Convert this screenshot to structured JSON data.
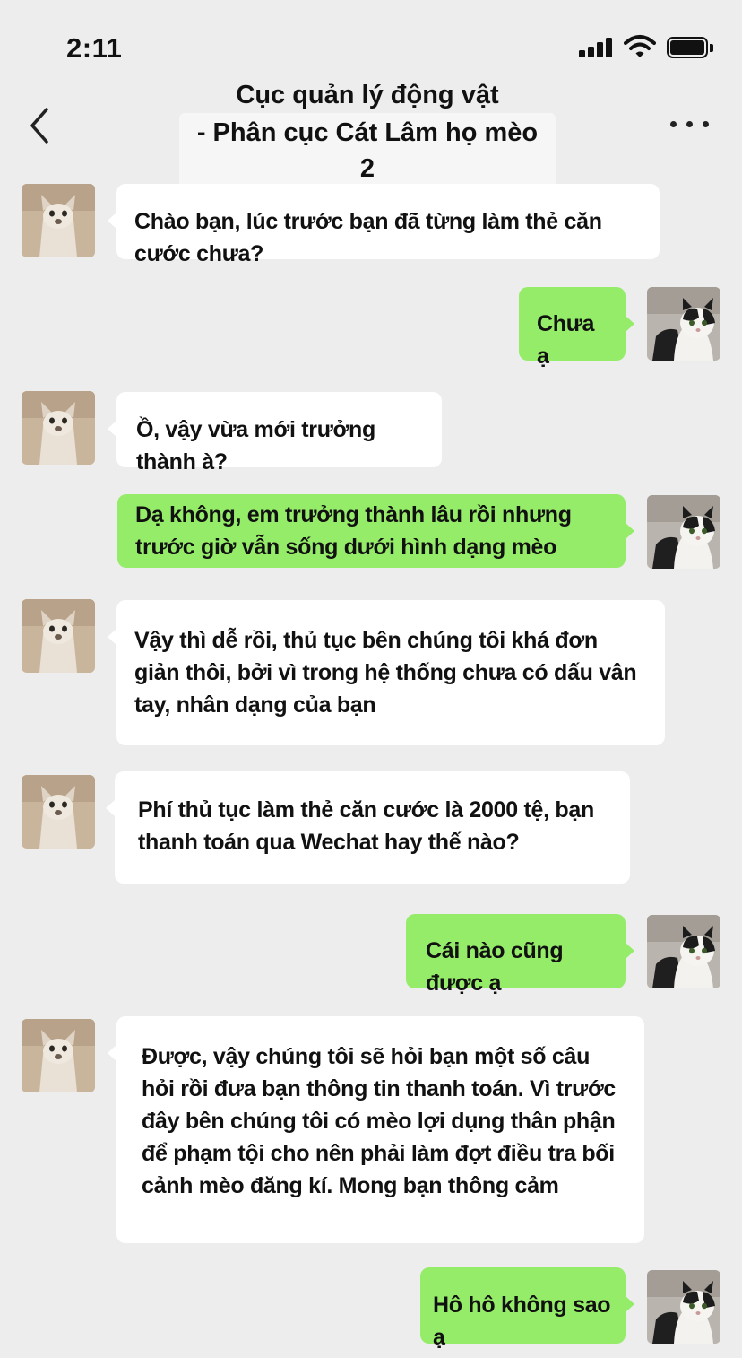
{
  "status": {
    "time": "2:11"
  },
  "header": {
    "title_line1": "Cục quản lý động vật",
    "title_line2": "- Phân cục Cát Lâm họ mèo 2"
  },
  "messages": [
    {
      "side": "left",
      "text": "Chào bạn, lúc trước bạn đã từng làm thẻ căn cước chưa?"
    },
    {
      "side": "right",
      "text": "Chưa ạ"
    },
    {
      "side": "left",
      "text": "Ồ, vậy vừa mới trưởng thành à?"
    },
    {
      "side": "right",
      "text": "Dạ không, em trưởng thành lâu rồi nhưng trước giờ vẫn sống dưới hình dạng mèo"
    },
    {
      "side": "left",
      "text": "Vậy thì dễ rồi, thủ tục bên chúng tôi khá đơn giản thôi, bởi vì trong hệ thống chưa có dấu vân tay, nhân dạng của bạn"
    },
    {
      "side": "left",
      "text": "Phí thủ tục làm thẻ căn cước là 2000 tệ, bạn thanh toán qua Wechat hay thế nào?"
    },
    {
      "side": "right",
      "text": "Cái nào cũng được ạ"
    },
    {
      "side": "left",
      "text": "Được, vậy chúng tôi sẽ hỏi bạn một số câu hỏi rồi đưa bạn thông tin thanh toán. Vì trước đây bên chúng tôi có mèo lợi dụng thân phận để phạm tội cho nên phải làm đợt điều tra bối cảnh mèo đăng kí. Mong bạn thông cảm"
    },
    {
      "side": "right",
      "text": "Hô hô không sao ạ"
    }
  ]
}
